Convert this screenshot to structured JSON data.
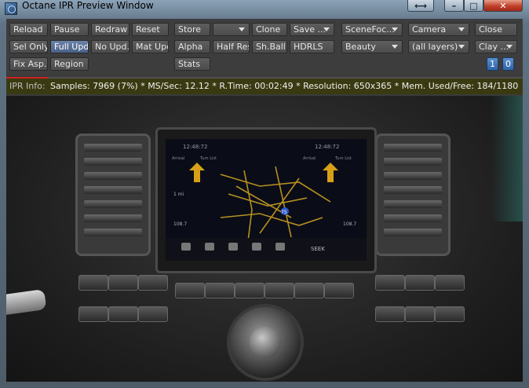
{
  "window": {
    "title": "Octane IPR Preview Window",
    "controls": {
      "resize_icon": "resize-arrows-icon",
      "minimize_icon": "minimize-icon",
      "maximize_icon": "maximize-icon",
      "close_icon": "close-icon"
    }
  },
  "toolbar": {
    "row1": [
      "Reload",
      "Pause",
      "Redraw",
      "Reset",
      "Store",
      "",
      "Clone",
      "Save ...",
      "SceneFoc...",
      "Camera",
      "Close"
    ],
    "row2": [
      "Sel Only",
      "Full Upd.",
      "No Upd.",
      "Mat Upd",
      "Alpha",
      "Half Res",
      "Sh.Ball",
      "HDRLS",
      "Beauty",
      "(all layers)",
      "Clay ..."
    ],
    "row3": [
      "Fix Asp.",
      "Region",
      "Stats"
    ],
    "page_buttons": [
      "1",
      "0"
    ],
    "active": "Full Upd."
  },
  "info": {
    "label": "IPR Info:",
    "text": "Samples: 7969 (7%)  *  MS/Sec: 12.12  *  R.Time: 00:02:49  *  Resolution: 650x365  *  Mem. Used/Free: 184/1180",
    "progress": 0.07
  },
  "screen": {
    "time": "12:48:72",
    "nav_time": "12:48:72",
    "labels": [
      "Arrival",
      "Turn List",
      "Arrival",
      "Turn List"
    ],
    "distance": "1 mi",
    "value_left": "108.7",
    "value_right": "108.7",
    "seek": "SEEK",
    "highway": "75"
  },
  "colors": {
    "info_bg": "#3a3a12",
    "accent_blue": "#4b6287",
    "progress_red": "#d02020"
  }
}
